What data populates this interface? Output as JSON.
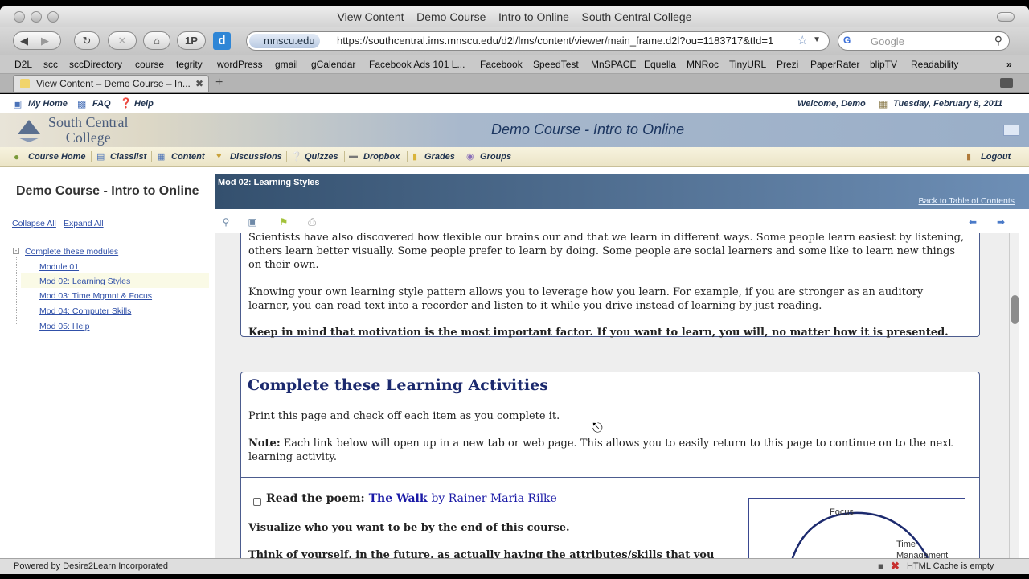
{
  "window": {
    "title": "View Content – Demo Course – Intro to Online – South Central College"
  },
  "toolbar": {
    "site_identity": "mnscu.edu",
    "url": "https://southcentral.ims.mnscu.edu/d2l/lms/content/viewer/main_frame.d2l?ou=1183717&tId=1",
    "onepassword_label": "1P",
    "search_placeholder": "Google"
  },
  "bookmarks": [
    "D2L",
    "scc",
    "sccDirectory",
    "course",
    "tegrity",
    "wordPress",
    "gmail",
    "gCalendar",
    "Facebook Ads 101 L...",
    "Facebook",
    "SpeedTest",
    "MnSPACE",
    "Equella",
    "MNRoc",
    "TinyURL",
    "Prezi",
    "PaperRater",
    "blipTV",
    "Readability"
  ],
  "tab": {
    "title": "View Content – Demo Course – In...",
    "new_tab": "+"
  },
  "topbar": {
    "my_home": "My Home",
    "faq": "FAQ",
    "help": "Help",
    "welcome": "Welcome, Demo",
    "date": "Tuesday, February 8, 2011"
  },
  "banner": {
    "logo_line1": "South Central",
    "logo_line2": "College",
    "course_title": "Demo Course - Intro to Online"
  },
  "nav": {
    "items": [
      "Course Home",
      "Classlist",
      "Content",
      "Discussions",
      "Quizzes",
      "Dropbox",
      "Grades",
      "Groups"
    ],
    "logout": "Logout"
  },
  "sidebar": {
    "title": "Demo Course - Intro to Online",
    "collapse_all": "Collapse All",
    "expand_all": "Expand All",
    "tree_root": "Complete these modules",
    "modules": [
      "Module 01",
      "Mod 02: Learning Styles",
      "Mod 03: Time Mgmnt & Focus",
      "Mod 04: Computer Skills",
      "Mod 05: Help"
    ],
    "selected_index": 1
  },
  "content": {
    "module_title": "Mod 02: Learning Styles",
    "back_link": "Back to Table of Contents",
    "para1_line1": "Scientists have also discovered how flexible our brains our and that we learn in different ways. Some people learn easiest by listening,",
    "para1_line2": "others learn better visually. Some people prefer to learn by doing. Some people are social learners and some like to learn new things",
    "para1_line3": "on their own.",
    "para2_line1": "Knowing your own learning style pattern allows you to leverage how you learn. For example, if you are stronger as an auditory",
    "para2_line2": "learner, you can read text into a recorder and listen to it while you drive instead of learning by just reading.",
    "keep_in_mind": "Keep in mind that motivation is the most important factor. If you want to learn, you will, no matter how it is presented.",
    "activities_heading": "Complete these Learning Activities",
    "print_text": "Print this page and check off each item as you complete it.",
    "note_label": "Note:",
    "note_line1": "Each link below will open up in a new tab or web page. This allows you to easily return to this page to continue on to the next",
    "note_line2": "learning activity.",
    "read_label": "Read the poem:",
    "poem_title": "The Walk",
    "poem_author": "by Rainer Maria Rilke",
    "visualize": "Visualize who you want to be by the end of this course.",
    "think": "Think of yourself, in the future, as actually having the attributes/skills that you",
    "diagram_focus": "Focus",
    "diagram_time_line1": "Time",
    "diagram_time_line2": "Management"
  },
  "status": {
    "left": "Powered by Desire2Learn Incorporated",
    "right": "HTML Cache is empty"
  }
}
